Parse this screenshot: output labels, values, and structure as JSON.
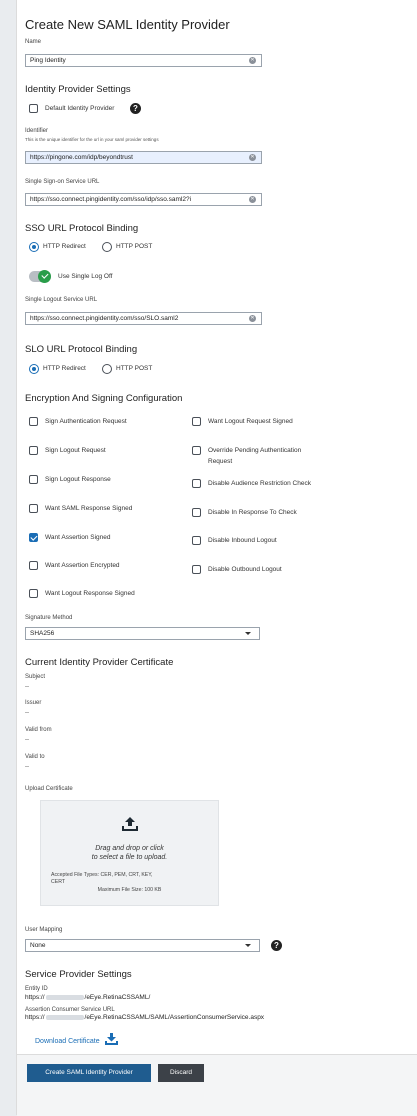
{
  "page_title": "Create New SAML Identity Provider",
  "name": {
    "label": "Name",
    "value": "Ping Identity"
  },
  "idp_settings": {
    "heading": "Identity Provider Settings",
    "default_label": "Default Identity Provider",
    "default_checked": false,
    "identifier_label": "Identifier",
    "identifier_hint": "This is the unique identifier for the url in your saml provider settings",
    "identifier_value": "https://pingone.com/idp/beyondtrust",
    "sso_url_label": "Single Sign-on Service URL",
    "sso_url_value": "https://sso.connect.pingidentity.com/sso/idp/sso.saml2?i"
  },
  "sso_binding": {
    "heading": "SSO URL Protocol Binding",
    "options": [
      "HTTP Redirect",
      "HTTP POST"
    ],
    "selected": "HTTP Redirect"
  },
  "single_logoff": {
    "label": "Use Single Log Off",
    "enabled": true
  },
  "slo_url": {
    "label": "Single Logout Service URL",
    "value": "https://sso.connect.pingidentity.com/sso/SLO.saml2"
  },
  "slo_binding": {
    "heading": "SLO URL Protocol Binding",
    "options": [
      "HTTP Redirect",
      "HTTP POST"
    ],
    "selected": "HTTP Redirect"
  },
  "encryption": {
    "heading": "Encryption And Signing Configuration",
    "left": [
      {
        "label": "Sign Authentication Request",
        "checked": false
      },
      {
        "label": "Sign Logout Request",
        "checked": false
      },
      {
        "label": "Sign Logout Response",
        "checked": false
      },
      {
        "label": "Want SAML Response Signed",
        "checked": false
      },
      {
        "label": "Want Assertion Signed",
        "checked": true
      },
      {
        "label": "Want Assertion Encrypted",
        "checked": false
      },
      {
        "label": "Want Logout Response Signed",
        "checked": false
      }
    ],
    "right": [
      {
        "label": "Want Logout Request Signed",
        "checked": false
      },
      {
        "label": "Override Pending Authentication",
        "label2": "Request",
        "checked": false
      },
      {
        "label": "Disable Audience Restriction Check",
        "checked": false
      },
      {
        "label": "Disable In Response To Check",
        "checked": false
      },
      {
        "label": "Disable Inbound Logout",
        "checked": false
      },
      {
        "label": "Disable Outbound Logout",
        "checked": false
      }
    ]
  },
  "signature": {
    "label": "Signature Method",
    "value": "SHA256"
  },
  "certificate": {
    "heading": "Current Identity Provider Certificate",
    "subject_label": "Subject",
    "subject_value": "--",
    "issuer_label": "Issuer",
    "issuer_value": "--",
    "valid_from_label": "Valid from",
    "valid_from_value": "--",
    "valid_to_label": "Valid to",
    "valid_to_value": "--"
  },
  "upload": {
    "label": "Upload Certificate",
    "line1": "Drag and drop or click",
    "line2": "to select a file to upload.",
    "types": "Accepted File Types: CER, PEM, CRT, KEY,",
    "types2": "CERT",
    "max": "Maximum File Size: 100 KB"
  },
  "user_mapping": {
    "label": "User Mapping",
    "value": "None"
  },
  "sp_settings": {
    "heading": "Service Provider Settings",
    "entity_label": "Entity ID",
    "entity_prefix": "https://",
    "entity_suffix": "/eEye.RetinaCSSAML/",
    "acs_label": "Assertion Consumer Service URL",
    "acs_prefix": "https://",
    "acs_suffix": "/eEye.RetinaCSSAML/SAML/AssertionConsumerService.aspx",
    "download_label": "Download Certificate"
  },
  "footer": {
    "create_label": "Create SAML Identity Provider",
    "discard_label": "Discard"
  },
  "colors": {
    "primary": "#1a6db5",
    "create_button": "#1f5c8f",
    "discard_button": "#3c4148",
    "toggle_on": "#2a9d4a"
  }
}
